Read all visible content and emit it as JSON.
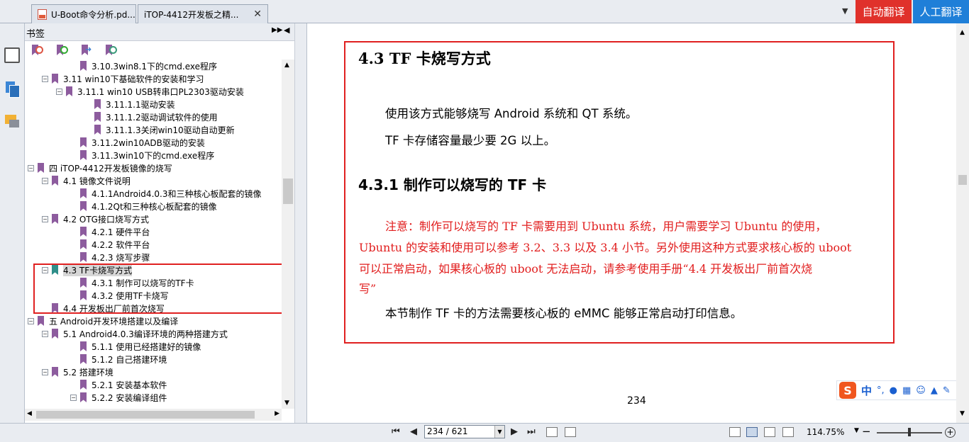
{
  "tabs": [
    {
      "label": "U-Boot命令分析.pd..."
    },
    {
      "label": "iTOP-4412开发板之精..."
    }
  ],
  "translate": {
    "auto": "自动翻译",
    "human": "人工翻译"
  },
  "panel": {
    "title": "书签"
  },
  "bookmarks": [
    {
      "label": "3.10.3win8.1下的cmd.exe程序",
      "level": 3,
      "toggle": "none"
    },
    {
      "label": "3.11 win10下基础软件的安装和学习",
      "level": 1,
      "toggle": "minus"
    },
    {
      "label": "3.11.1 win10 USB转串口PL2303驱动安装",
      "level": 2,
      "toggle": "minus"
    },
    {
      "label": "3.11.1.1驱动安装",
      "level": 4,
      "toggle": "none"
    },
    {
      "label": "3.11.1.2驱动调试软件的使用",
      "level": 4,
      "toggle": "none"
    },
    {
      "label": "3.11.1.3关闭win10驱动自动更新",
      "level": 4,
      "toggle": "none"
    },
    {
      "label": "3.11.2win10ADB驱动的安装",
      "level": 3,
      "toggle": "none"
    },
    {
      "label": "3.11.3win10下的cmd.exe程序",
      "level": 3,
      "toggle": "none"
    },
    {
      "label": "四 iTOP-4412开发板镜像的烧写",
      "level": 0,
      "toggle": "minus"
    },
    {
      "label": "4.1 镜像文件说明",
      "level": 1,
      "toggle": "minus"
    },
    {
      "label": "4.1.1Android4.0.3和三种核心板配套的镜像",
      "level": 3,
      "toggle": "none"
    },
    {
      "label": "4.1.2Qt和三种核心板配套的镜像",
      "level": 3,
      "toggle": "none"
    },
    {
      "label": "4.2 OTG接口烧写方式",
      "level": 1,
      "toggle": "minus"
    },
    {
      "label": "4.2.1 硬件平台",
      "level": 3,
      "toggle": "none"
    },
    {
      "label": "4.2.2 软件平台",
      "level": 3,
      "toggle": "none"
    },
    {
      "label": "4.2.3 烧写步骤",
      "level": 3,
      "toggle": "none"
    },
    {
      "label": "4.3 TF卡烧写方式",
      "level": 1,
      "toggle": "minus",
      "selected": true
    },
    {
      "label": "4.3.1 制作可以烧写的TF卡",
      "level": 3,
      "toggle": "none"
    },
    {
      "label": "4.3.2 使用TF卡烧写",
      "level": 3,
      "toggle": "none"
    },
    {
      "label": "4.4 开发板出厂前首次烧写",
      "level": 1,
      "toggle": "none"
    },
    {
      "label": "五 Android开发环境搭建以及编译",
      "level": 0,
      "toggle": "minus"
    },
    {
      "label": "5.1 Android4.0.3编译环境的两种搭建方式",
      "level": 1,
      "toggle": "minus"
    },
    {
      "label": "5.1.1 使用已经搭建好的镜像",
      "level": 3,
      "toggle": "none"
    },
    {
      "label": "5.1.2 自己搭建环境",
      "level": 3,
      "toggle": "none"
    },
    {
      "label": "5.2 搭建环境",
      "level": 1,
      "toggle": "minus"
    },
    {
      "label": "5.2.1 安装基本软件",
      "level": 3,
      "toggle": "none"
    },
    {
      "label": "5.2.2 安装编译组件",
      "level": 3,
      "toggle": "minus"
    }
  ],
  "document": {
    "section_heading": "4.3 TF 卡烧写方式",
    "para1": "使用该方式能够烧写 Android 系统和 QT 系统。",
    "para2": "TF 卡存储容量最少要 2G 以上。",
    "subsection_heading": "4.3.1  制作可以烧写的 TF 卡",
    "note_lines": [
      "注意：制作可以烧写的 TF 卡需要用到 Ubuntu 系统，用户需要学习 Ubuntu 的使用，",
      "Ubuntu 的安装和使用可以参考 3.2、3.3 以及 3.4 小节。另外使用这种方式要求核心板的 uboot",
      "可以正常启动，如果核心板的 uboot 无法启动，请参考使用手册“4.4 开发板出厂前首次烧",
      "写”"
    ],
    "para3": "本节制作 TF 卡的方法需要核心板的 eMMC 能够正常启动打印信息。",
    "page_number": "234"
  },
  "ime": {
    "language": "中"
  },
  "status": {
    "page_field": "234 / 621",
    "zoom": "114.75%",
    "zoom_in": "+",
    "zoom_out": "−"
  },
  "colors": {
    "annotation": "#e02020",
    "note_text": "#e11d1d",
    "auto_translate": "#e0312b",
    "human_translate": "#1f7fd8",
    "bookmark": "#8d5c9e"
  }
}
